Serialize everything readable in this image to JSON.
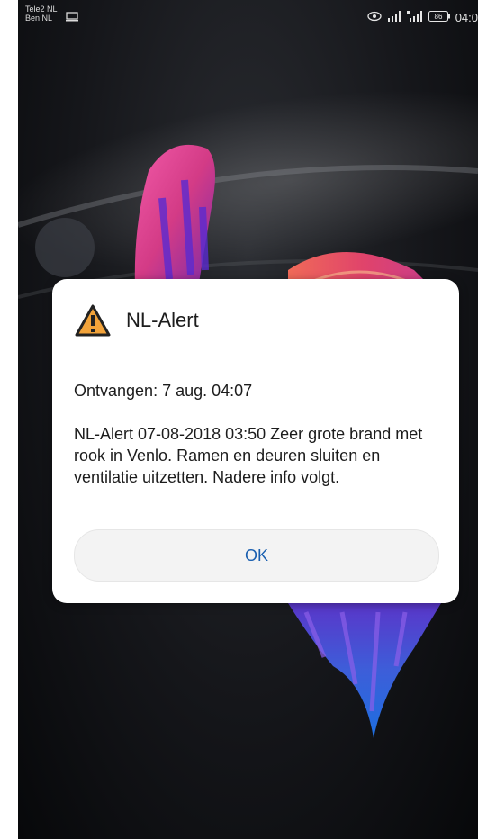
{
  "statusbar": {
    "carrier_line1": "Tele2 NL",
    "carrier_line2": "Ben NL",
    "time": "04:0",
    "battery": "86",
    "left_icon": "cast-icon",
    "right_icons": [
      "eye-icon",
      "signal-icon",
      "signal-4g-icon",
      "battery-icon"
    ]
  },
  "dialog": {
    "title": "NL-Alert",
    "icon": "warning-icon",
    "received": "Ontvangen: 7 aug. 04:07",
    "message": "NL-Alert 07-08-2018 03:50 Zeer grote brand met rook in Venlo. Ramen en deuren sluiten en ventilatie uitzetten. Nadere info volgt.",
    "ok_label": "OK"
  },
  "colors": {
    "accent": "#1a5fb0",
    "warning": "#f2a33a",
    "background": "#15161a"
  }
}
